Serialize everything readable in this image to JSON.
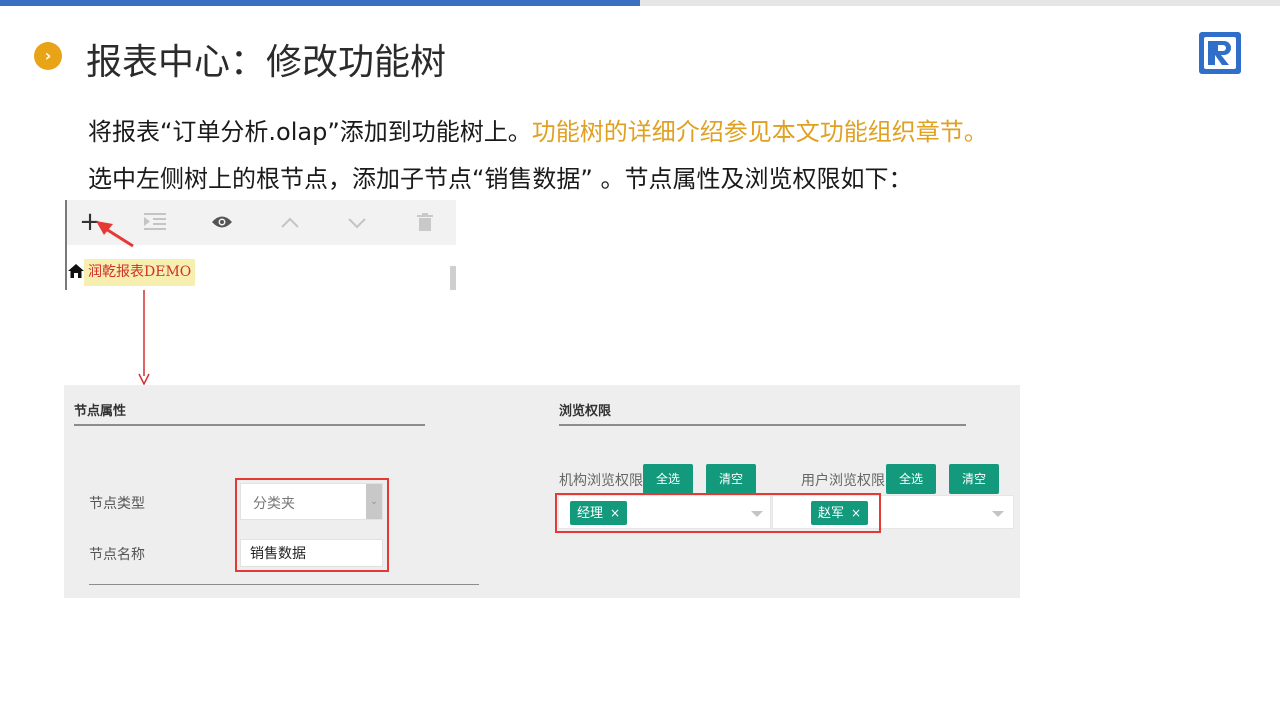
{
  "page": {
    "title": "报表中心：修改功能树",
    "bullet_glyph": "›",
    "accent_color": "#e8a317",
    "topbar_color": "#3b6fc4"
  },
  "instructions": {
    "line1_plain": "将报表“订单分析.olap”添加到功能树上。",
    "line1_highlight": "功能树的详细介绍参见本文功能组织章节。",
    "line2": "选中左侧树上的根节点，添加子节点“销售数据” 。节点属性及浏览权限如下：",
    "highlight_color": "#e0a020"
  },
  "tree": {
    "toolbar_icons": [
      "add-icon",
      "indent-icon",
      "eye-icon",
      "up-icon",
      "down-icon",
      "trash-icon"
    ],
    "add_glyph": "+",
    "indent_glyph": "⇥",
    "eye_glyph": "👁",
    "up_glyph": "︿",
    "down_glyph": "﹀",
    "trash_glyph": "🗑",
    "root_label": "润乾报表DEMO"
  },
  "node_props": {
    "section_title": "节点属性",
    "type_label": "节点类型",
    "type_value": "分类夹",
    "name_label": "节点名称",
    "name_value": "销售数据"
  },
  "permissions": {
    "section_title": "浏览权限",
    "org_label": "机构浏览权限",
    "user_label": "用户浏览权限",
    "select_all": "全选",
    "clear": "清空",
    "org_tag": "经理",
    "user_tag": "赵军",
    "tag_remove": "×",
    "tag_color": "#139a7c"
  }
}
